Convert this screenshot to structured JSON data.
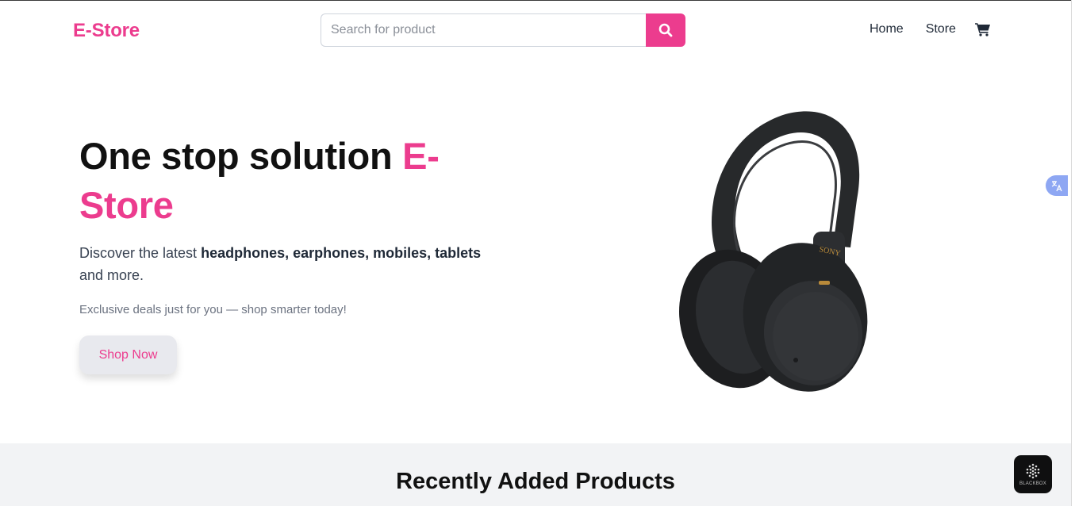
{
  "header": {
    "logo": "E-Store",
    "search": {
      "placeholder": "Search for product",
      "value": ""
    },
    "nav": {
      "home": "Home",
      "store": "Store"
    }
  },
  "hero": {
    "title_main": "One stop solution",
    "title_accent_1": "E-",
    "title_accent_2": "Store",
    "desc_prefix": "Discover the latest",
    "desc_bold": "headphones, earphones, mobiles, tablets",
    "desc_suffix": "and more.",
    "subtitle": "Exclusive deals just for you — shop smarter today!",
    "cta": "Shop Now",
    "image_brand": "SONY"
  },
  "recent": {
    "title": "Recently Added Products"
  },
  "widgets": {
    "blackbox_label": "BLACKBOX"
  },
  "icons": [
    "search-icon",
    "cart-icon",
    "translate-icon",
    "blackbox-icon"
  ],
  "colors": {
    "accent": "#ec3c8e",
    "section_bg": "#f2f3f5",
    "button_bg": "#e8e9ee"
  }
}
